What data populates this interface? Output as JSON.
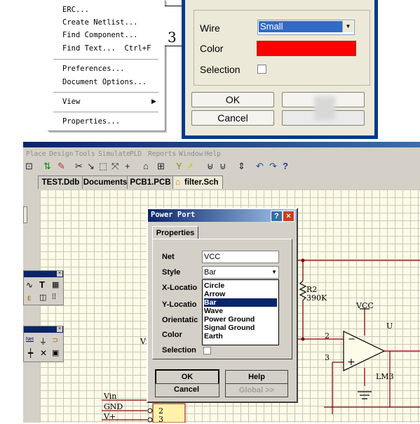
{
  "context_menu": {
    "items": [
      {
        "label": "ERC..."
      },
      {
        "label": "Create Netlist..."
      },
      {
        "label": "Find Component..."
      },
      {
        "label": "Find Text...  Ctrl+F"
      },
      {
        "label": "Preferences..."
      },
      {
        "label": "Document Options..."
      },
      {
        "label": "View"
      },
      {
        "label": "Properties..."
      }
    ]
  },
  "sheet_number": "3",
  "wire_dialog": {
    "wire_label": "Wire",
    "wire_value": "Small",
    "color_label": "Color",
    "color_value": "#ff0000",
    "selection_label": "Selection",
    "ok_label": "OK",
    "cancel_label": "Cancel"
  },
  "menubar": [
    "Place",
    "Design",
    "Tools",
    "Simulate",
    "PLD",
    "Reports",
    "Window",
    "Help"
  ],
  "tabs": [
    {
      "label": "TEST.Ddb"
    },
    {
      "label": "Documents"
    },
    {
      "label": "PCB1.PCB"
    },
    {
      "label": "filter.Sch"
    }
  ],
  "power_port": {
    "title": "Power Port",
    "tab": "Properties",
    "net_label": "Net",
    "net_value": "VCC",
    "style_label": "Style",
    "style_value": "Bar",
    "style_options": [
      "Circle",
      "Arrow",
      "Bar",
      "Wave",
      "Power Ground",
      "Signal Ground",
      "Earth"
    ],
    "selected_option": "Bar",
    "x_label": "X-Locatio",
    "y_label": "Y-Locatio",
    "orient_label": "Orientatic",
    "color_label": "Color",
    "selection_label": "Selection",
    "ok_label": "OK",
    "help_label": "Help",
    "global_label": "Global >>"
  },
  "schematic": {
    "r2_label": "R2",
    "r2_value": "390K",
    "vcc_label": "VCC",
    "pin2": "2",
    "pin3": "3",
    "opamp_label": "LM3",
    "u_label": "U",
    "vi_label": "Vi",
    "net_vin": "Vin",
    "net_gnd": "GND",
    "net_vplus": "V+",
    "conn_pin2": "2",
    "conn_pin3": "3",
    "palette_net": "Net",
    "plus_sign": "+",
    "minus_sign": "−"
  }
}
